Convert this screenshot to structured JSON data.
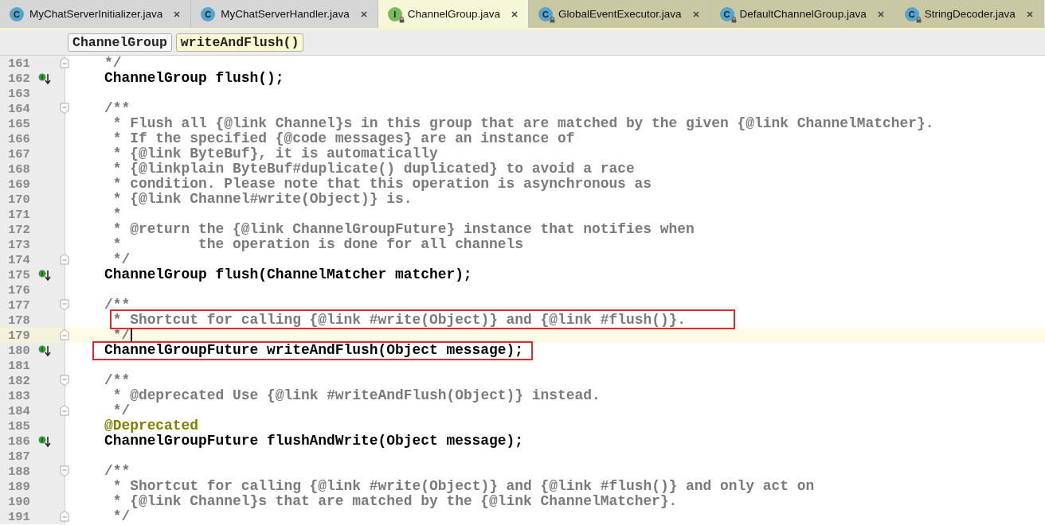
{
  "tabs": [
    {
      "label": "MyChatServerInitializer.java",
      "icon": "C",
      "kind": "class",
      "library": false,
      "selected": false
    },
    {
      "label": "MyChatServerHandler.java",
      "icon": "C",
      "kind": "class",
      "library": false,
      "selected": false
    },
    {
      "label": "ChannelGroup.java",
      "icon": "I",
      "kind": "interface",
      "library": true,
      "selected": true
    },
    {
      "label": "GlobalEventExecutor.java",
      "icon": "C",
      "kind": "class",
      "library": true,
      "selected": false
    },
    {
      "label": "DefaultChannelGroup.java",
      "icon": "C",
      "kind": "class",
      "library": true,
      "selected": false
    },
    {
      "label": "StringDecoder.java",
      "icon": "C",
      "kind": "class",
      "library": true,
      "selected": false
    }
  ],
  "breadcrumbs": [
    {
      "label": "ChannelGroup",
      "selected": false
    },
    {
      "label": "writeAndFlush()",
      "selected": true
    }
  ],
  "lines": [
    {
      "number": "161",
      "kind": "comment",
      "text": "    */",
      "fold_end": true
    },
    {
      "number": "162",
      "kind": "code",
      "text": "    ChannelGroup flush();",
      "marker": true
    },
    {
      "number": "163"
    },
    {
      "number": "164",
      "kind": "comment",
      "text": "    /**",
      "fold_start": true
    },
    {
      "number": "165",
      "kind": "comment",
      "text": "     * Flush all {**@link** **Channel**}s in this group that are matched by the given {**@link** **ChannelMatcher**}."
    },
    {
      "number": "166",
      "kind": "comment",
      "text": "     * If the specified {**@code** messages} are an instance of"
    },
    {
      "number": "167",
      "kind": "comment",
      "text": "     * {**@link** **ByteBuf**}, it is automatically"
    },
    {
      "number": "168",
      "kind": "comment",
      "text": "     * {**@linkplain** **ByteBuf#duplicate**() duplicated} to avoid a race"
    },
    {
      "number": "169",
      "kind": "comment",
      "text": "     * condition. Please note that this operation is asynchronous as"
    },
    {
      "number": "170",
      "kind": "comment",
      "text": "     * {**@link** **Channel#write**(**Object**)} is."
    },
    {
      "number": "171",
      "kind": "comment",
      "text": "     *"
    },
    {
      "number": "172",
      "kind": "comment",
      "text": "     * **@return** the {**@link** **ChannelGroupFuture**} instance that notifies when"
    },
    {
      "number": "173",
      "kind": "comment",
      "text": "     *         the operation is done for all channels"
    },
    {
      "number": "174",
      "kind": "comment",
      "text": "     */",
      "fold_end": true
    },
    {
      "number": "175",
      "kind": "code",
      "text": "    ChannelGroup flush(ChannelMatcher matcher);",
      "marker": true
    },
    {
      "number": "176"
    },
    {
      "number": "177",
      "kind": "comment",
      "text": "    /**",
      "fold_start": true
    },
    {
      "number": "178",
      "kind": "comment",
      "text": "     * Shortcut for calling {**@link** **#write**(**Object**)} and {**@link** **#flush**()}.",
      "boxed": true
    },
    {
      "number": "179",
      "kind": "comment",
      "text": "     */",
      "fold_end": true,
      "current": true
    },
    {
      "number": "180",
      "kind": "code",
      "text": "    ChannelGroupFuture writeAndFlush(Object message);",
      "marker": true,
      "boxed": true
    },
    {
      "number": "181"
    },
    {
      "number": "182",
      "kind": "comment",
      "text": "    /**",
      "fold_start": true
    },
    {
      "number": "183",
      "kind": "comment",
      "text": "     * **@deprecated** Use {**@link** **#writeAndFlush**(**Object**)} instead."
    },
    {
      "number": "184",
      "kind": "comment",
      "text": "     */",
      "fold_end": true
    },
    {
      "number": "185",
      "kind": "annotation",
      "text": "    @Deprecated"
    },
    {
      "number": "186",
      "kind": "code",
      "text": "    ChannelGroupFuture flushAndWrite(Object message);",
      "marker": true
    },
    {
      "number": "187"
    },
    {
      "number": "188",
      "kind": "comment",
      "text": "    /**",
      "fold_start": true
    },
    {
      "number": "189",
      "kind": "comment",
      "text": "     * Shortcut for calling {**@link** **#write**(**Object**)} and {**@link** **#flush**()} and only act on"
    },
    {
      "number": "190",
      "kind": "comment",
      "text": "     * {**@link** **Channel**}s that are matched by the {**@link** **ChannelMatcher**}."
    },
    {
      "number": "191",
      "kind": "comment",
      "text": "     */",
      "fold_end": true
    }
  ]
}
